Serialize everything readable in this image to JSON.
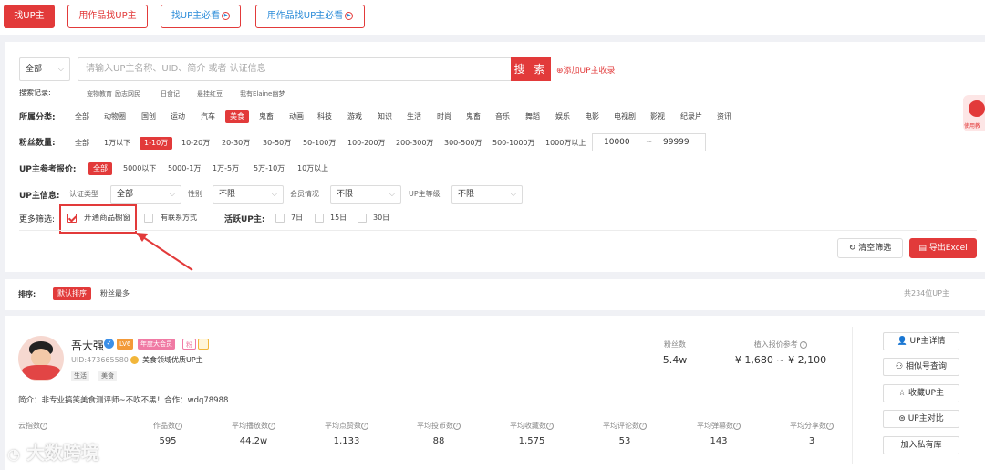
{
  "topnav": {
    "find_up": "找UP主",
    "find_by_works": "用作品找UP主",
    "find_up_must_see": "找UP主必看",
    "find_by_works_must_see": "用作品找UP主必看"
  },
  "search": {
    "scope": "全部",
    "placeholder": "请输入UP主名称、UID、简介 或者 认证信息",
    "button": "搜 索",
    "add_link": "添加UP主收录"
  },
  "history": {
    "label": "搜索记录:",
    "items": [
      "宠物教育",
      "励志网民",
      "日食记",
      "悬挂红豆",
      "我有Elaine幽梦"
    ]
  },
  "category": {
    "label": "所属分类:",
    "items": [
      "全部",
      "动物圈",
      "国创",
      "运动",
      "汽车",
      "美食",
      "鬼畜",
      "动画",
      "科技",
      "游戏",
      "知识",
      "生活",
      "时尚",
      "鬼畜",
      "音乐",
      "舞蹈",
      "娱乐",
      "电影",
      "电视剧",
      "影视",
      "纪录片",
      "资讯"
    ],
    "active": "美食"
  },
  "fans": {
    "label": "粉丝数量:",
    "items": [
      "全部",
      "1万以下",
      "1-10万",
      "10-20万",
      "20-30万",
      "30-50万",
      "50-100万",
      "100-200万",
      "200-300万",
      "300-500万",
      "500-1000万",
      "1000万以上"
    ],
    "active": "1-10万",
    "range_min": "10000",
    "range_sep": "~",
    "range_max": "99999"
  },
  "price": {
    "label": "UP主参考报价:",
    "items": [
      "全部",
      "5000以下",
      "5000-1万",
      "1万-5万",
      "5万-10万",
      "10万以上"
    ],
    "active": "全部"
  },
  "info": {
    "label": "UP主信息:",
    "cert_label": "认证类型",
    "cert_value": "全部",
    "gender_label": "性别",
    "gender_value": "不限",
    "member_label": "会员情况",
    "member_value": "不限",
    "level_label": "UP主等级",
    "level_value": "不限"
  },
  "more": {
    "label": "更多筛选:",
    "shop_window": "开通商品橱窗",
    "contact": "有联系方式",
    "active_label": "活跃UP主:",
    "d7": "7日",
    "d15": "15日",
    "d30": "30日"
  },
  "actions": {
    "clear": "清空筛选",
    "export": "导出Excel"
  },
  "sort": {
    "label": "排序:",
    "default": "默认排序",
    "most_fans": "粉丝最多",
    "total": "共234位UP主"
  },
  "card": {
    "name": "吾大强",
    "level": "LV6",
    "vip": "年度大会员",
    "fan_badge": "粉",
    "uid": "UID:473665580",
    "cert": "美食领域优质UP主",
    "tags": [
      "生活",
      "美食"
    ],
    "intro": "简介：非专业搞笑美食测评师~不吹不黑！合作：wdq78988",
    "fans_label": "粉丝数",
    "fans_value": "5.4w",
    "price_label": "植入报价参考",
    "price_value": "¥ 1,680 ~ ¥ 2,100",
    "cloud_label": "云指数",
    "stats": [
      {
        "label": "作品数",
        "value": "595"
      },
      {
        "label": "平均播放数",
        "value": "44.2w"
      },
      {
        "label": "平均点赞数",
        "value": "1,133"
      },
      {
        "label": "平均投币数",
        "value": "88"
      },
      {
        "label": "平均收藏数",
        "value": "1,575"
      },
      {
        "label": "平均评论数",
        "value": "53"
      },
      {
        "label": "平均弹幕数",
        "value": "143"
      },
      {
        "label": "平均分享数",
        "value": "3"
      }
    ],
    "side_buttons": [
      "UP主详情",
      "相似号查询",
      "收藏UP主",
      "UP主对比",
      "加入私有库"
    ]
  },
  "float_badge": "使用教",
  "watermark": "大数跨境",
  "colors": {
    "accent": "#e23a3a"
  }
}
